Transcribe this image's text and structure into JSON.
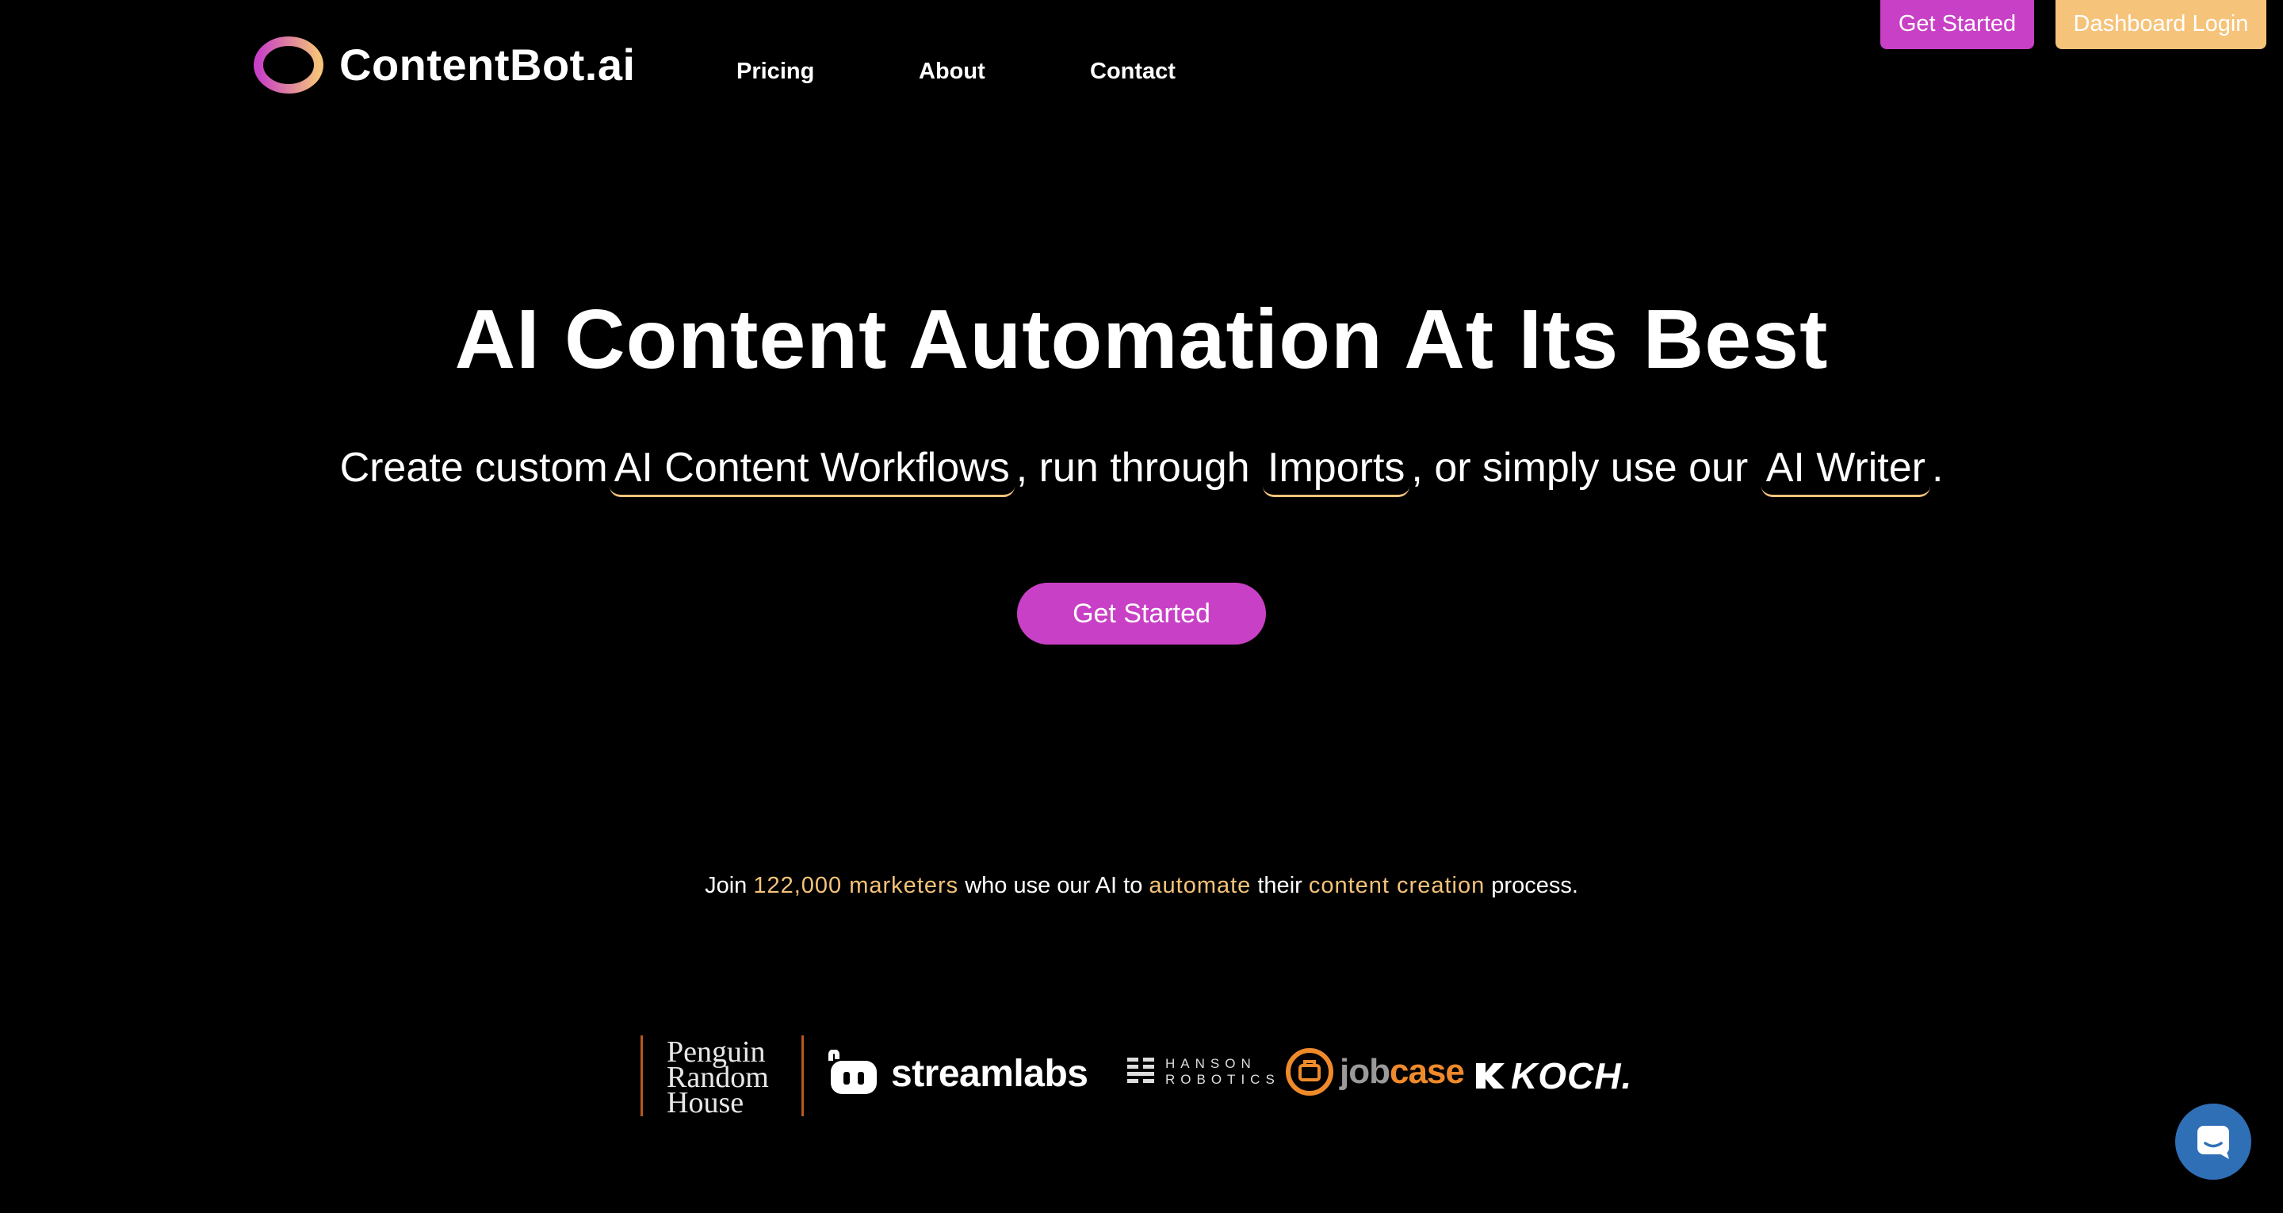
{
  "brand": {
    "name": "ContentBot.ai",
    "gradient_from": "#c840c6",
    "gradient_to": "#f5c37a"
  },
  "nav": {
    "items": [
      "Pricing",
      "About",
      "Contact"
    ]
  },
  "header_buttons": {
    "get_started": "Get Started",
    "dashboard_login": "Dashboard Login"
  },
  "hero": {
    "title": "AI Content Automation At Its Best",
    "subtitle_parts": {
      "p1": "Create custom",
      "link1": "AI Content Workflows",
      "p2": ", run through",
      "link2": "Imports",
      "p3": ", or simply use our",
      "link3": "AI Writer",
      "p4": "."
    },
    "cta": "Get Started"
  },
  "social_proof": {
    "p1": "Join",
    "hl1": "122,000 marketers",
    "p2": "who use our AI to",
    "hl2": "automate",
    "p3": "their",
    "hl3": "content creation",
    "p4": "process."
  },
  "client_logos": {
    "penguin": [
      "Penguin",
      "Random",
      "House"
    ],
    "streamlabs": "streamlabs",
    "hanson": [
      "HANSON",
      "ROBOTICS"
    ],
    "jobcase": {
      "a": "job",
      "b": "case"
    },
    "koch": "KOCH."
  },
  "colors": {
    "background": "#000000",
    "accent_purple": "#c840c6",
    "accent_gold": "#f5c37a",
    "chat_blue": "#2f6fb5"
  },
  "icons": {
    "logo": "contentbot-ring-icon",
    "chat": "chat-bubble-icon"
  }
}
